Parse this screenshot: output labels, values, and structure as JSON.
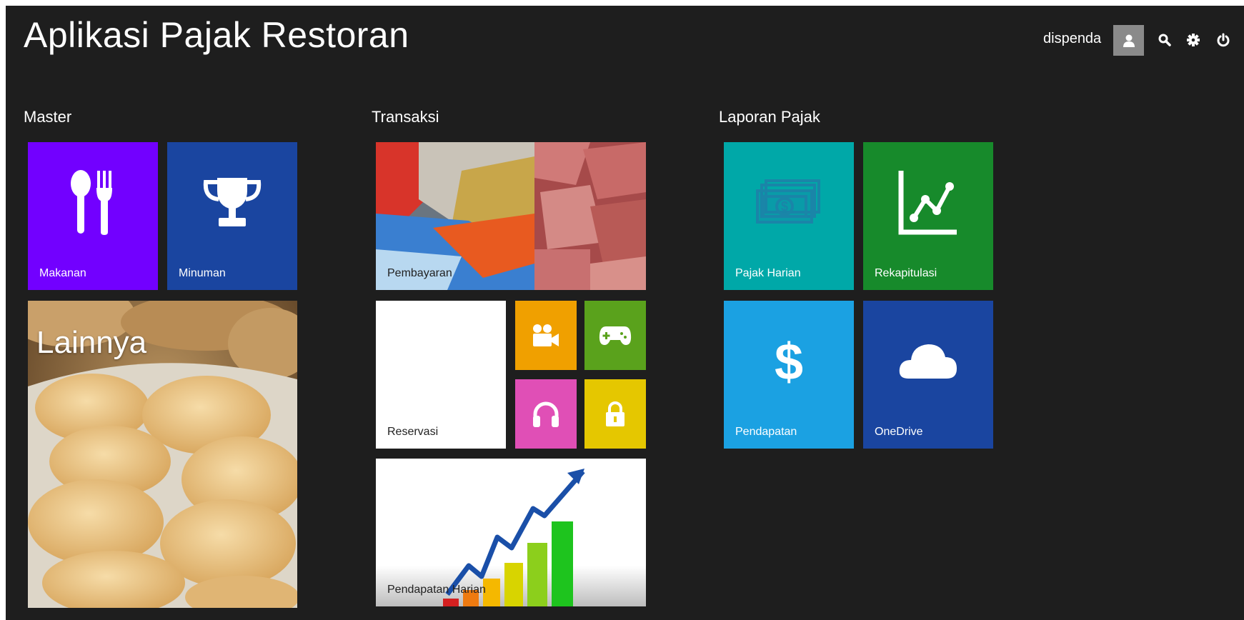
{
  "app": {
    "title": "Aplikasi Pajak Restoran"
  },
  "header": {
    "user_name": "dispenda",
    "icons": [
      "user-icon",
      "search-icon",
      "gear-icon",
      "power-icon"
    ]
  },
  "groups": {
    "master": {
      "title": "Master",
      "tiles": {
        "makanan": {
          "label": "Makanan",
          "color": "#7200ff",
          "icon": "fork-spoon-icon"
        },
        "minuman": {
          "label": "Minuman",
          "color": "#1a45a0",
          "icon": "trophy-icon"
        },
        "lainnya": {
          "label": "Lainnya"
        }
      }
    },
    "transaksi": {
      "title": "Transaksi",
      "tiles": {
        "pembayaran": {
          "label": "Pembayaran"
        },
        "reservasi": {
          "label": "Reservasi",
          "color": "#ffffff"
        },
        "video": {
          "color": "#f0a000",
          "icon": "video-camera-icon"
        },
        "games": {
          "color": "#5aa21c",
          "icon": "gamepad-icon"
        },
        "music": {
          "color": "#e04fb6",
          "icon": "headphones-icon"
        },
        "lock": {
          "color": "#e5c700",
          "icon": "lock-icon"
        },
        "pendapatan_harian": {
          "label": "Pendapatan Harian"
        }
      }
    },
    "laporan": {
      "title": "Laporan Pajak",
      "tiles": {
        "pajak_harian": {
          "label": "Pajak Harian",
          "color": "#00a8a8",
          "icon": "money-icon"
        },
        "rekapitulasi": {
          "label": "Rekapitulasi",
          "color": "#178a2b",
          "icon": "line-chart-icon"
        },
        "pendapatan": {
          "label": "Pendapatan",
          "color": "#1ba1e2",
          "icon": "dollar-icon"
        },
        "onedrive": {
          "label": "OneDrive",
          "color": "#1a45a0",
          "icon": "cloud-icon"
        }
      }
    }
  }
}
